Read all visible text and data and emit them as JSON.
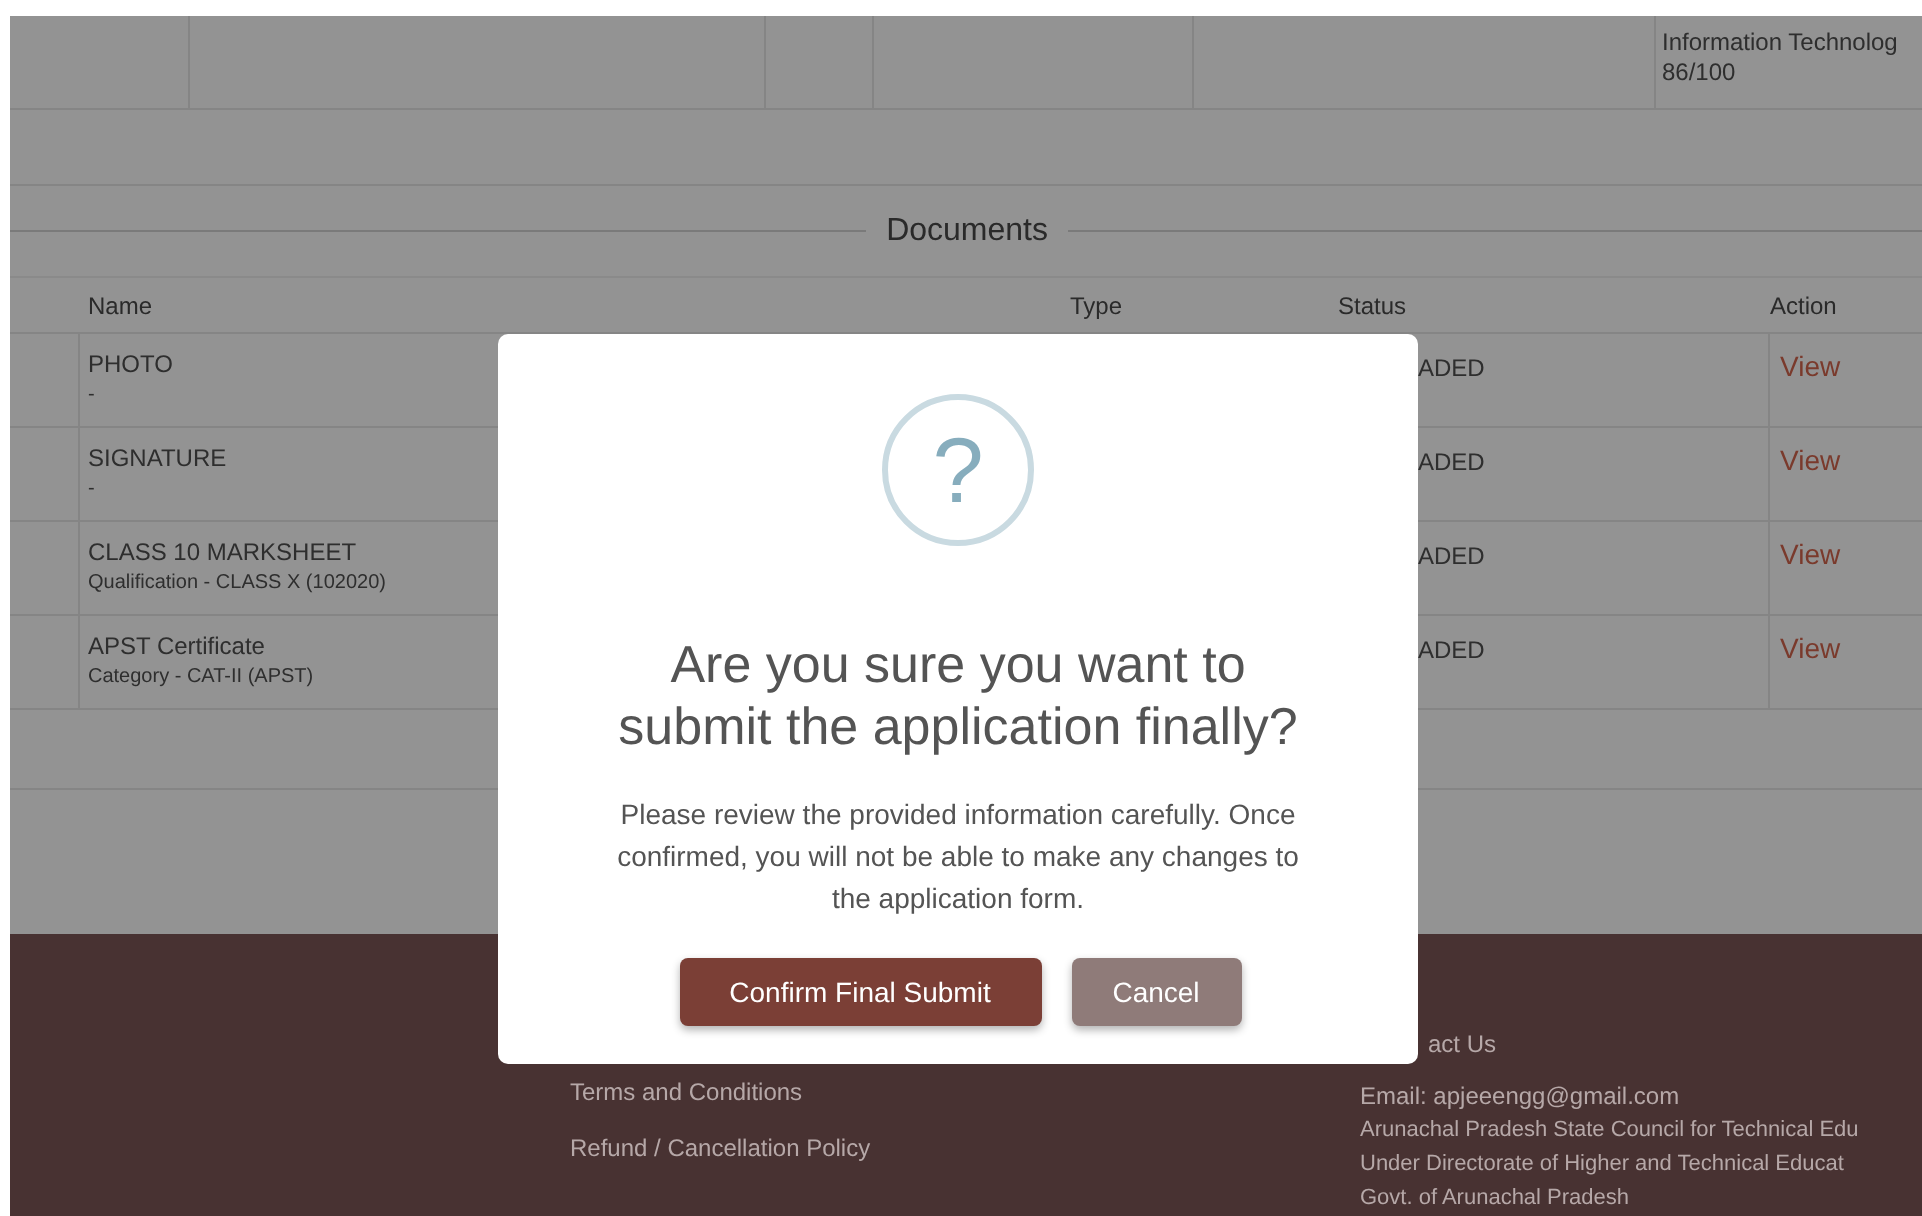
{
  "top_row": {
    "last_cell": [
      "Information Technolog",
      "86/100"
    ]
  },
  "documents": {
    "title": "Documents",
    "columns": [
      "Name",
      "Type",
      "Status",
      "Action"
    ],
    "rows": [
      {
        "name": "PHOTO",
        "sub": "-",
        "status": "ADED",
        "action": "View"
      },
      {
        "name": "SIGNATURE",
        "sub": "-",
        "status": "ADED",
        "action": "View"
      },
      {
        "name": "CLASS 10 MARKSHEET",
        "sub": "Qualification - CLASS X (102020)",
        "status": "ADED",
        "action": "View"
      },
      {
        "name": "APST Certificate",
        "sub": "Category - CAT-II (APST)",
        "status": "ADED",
        "action": "View"
      }
    ]
  },
  "footer": {
    "links": [
      "Terms and Conditions",
      "Refund / Cancellation Policy"
    ],
    "contact_heading": "act Us",
    "contact_lines": [
      "Email: apjeeengg@gmail.com",
      "Arunachal Pradesh State Council for Technical Edu",
      "Under Directorate of Higher and Technical Educat",
      "Govt. of Arunachal Pradesh"
    ]
  },
  "dialog": {
    "icon": "?",
    "title": "Are you sure you want to submit the application finally?",
    "message": "Please review the provided information carefully. Once confirmed, you will not be able to make any changes to the application form.",
    "buttons": [
      {
        "label": "Confirm Final Submit",
        "kind": "primary"
      },
      {
        "label": "Cancel",
        "kind": "secondary"
      }
    ]
  }
}
